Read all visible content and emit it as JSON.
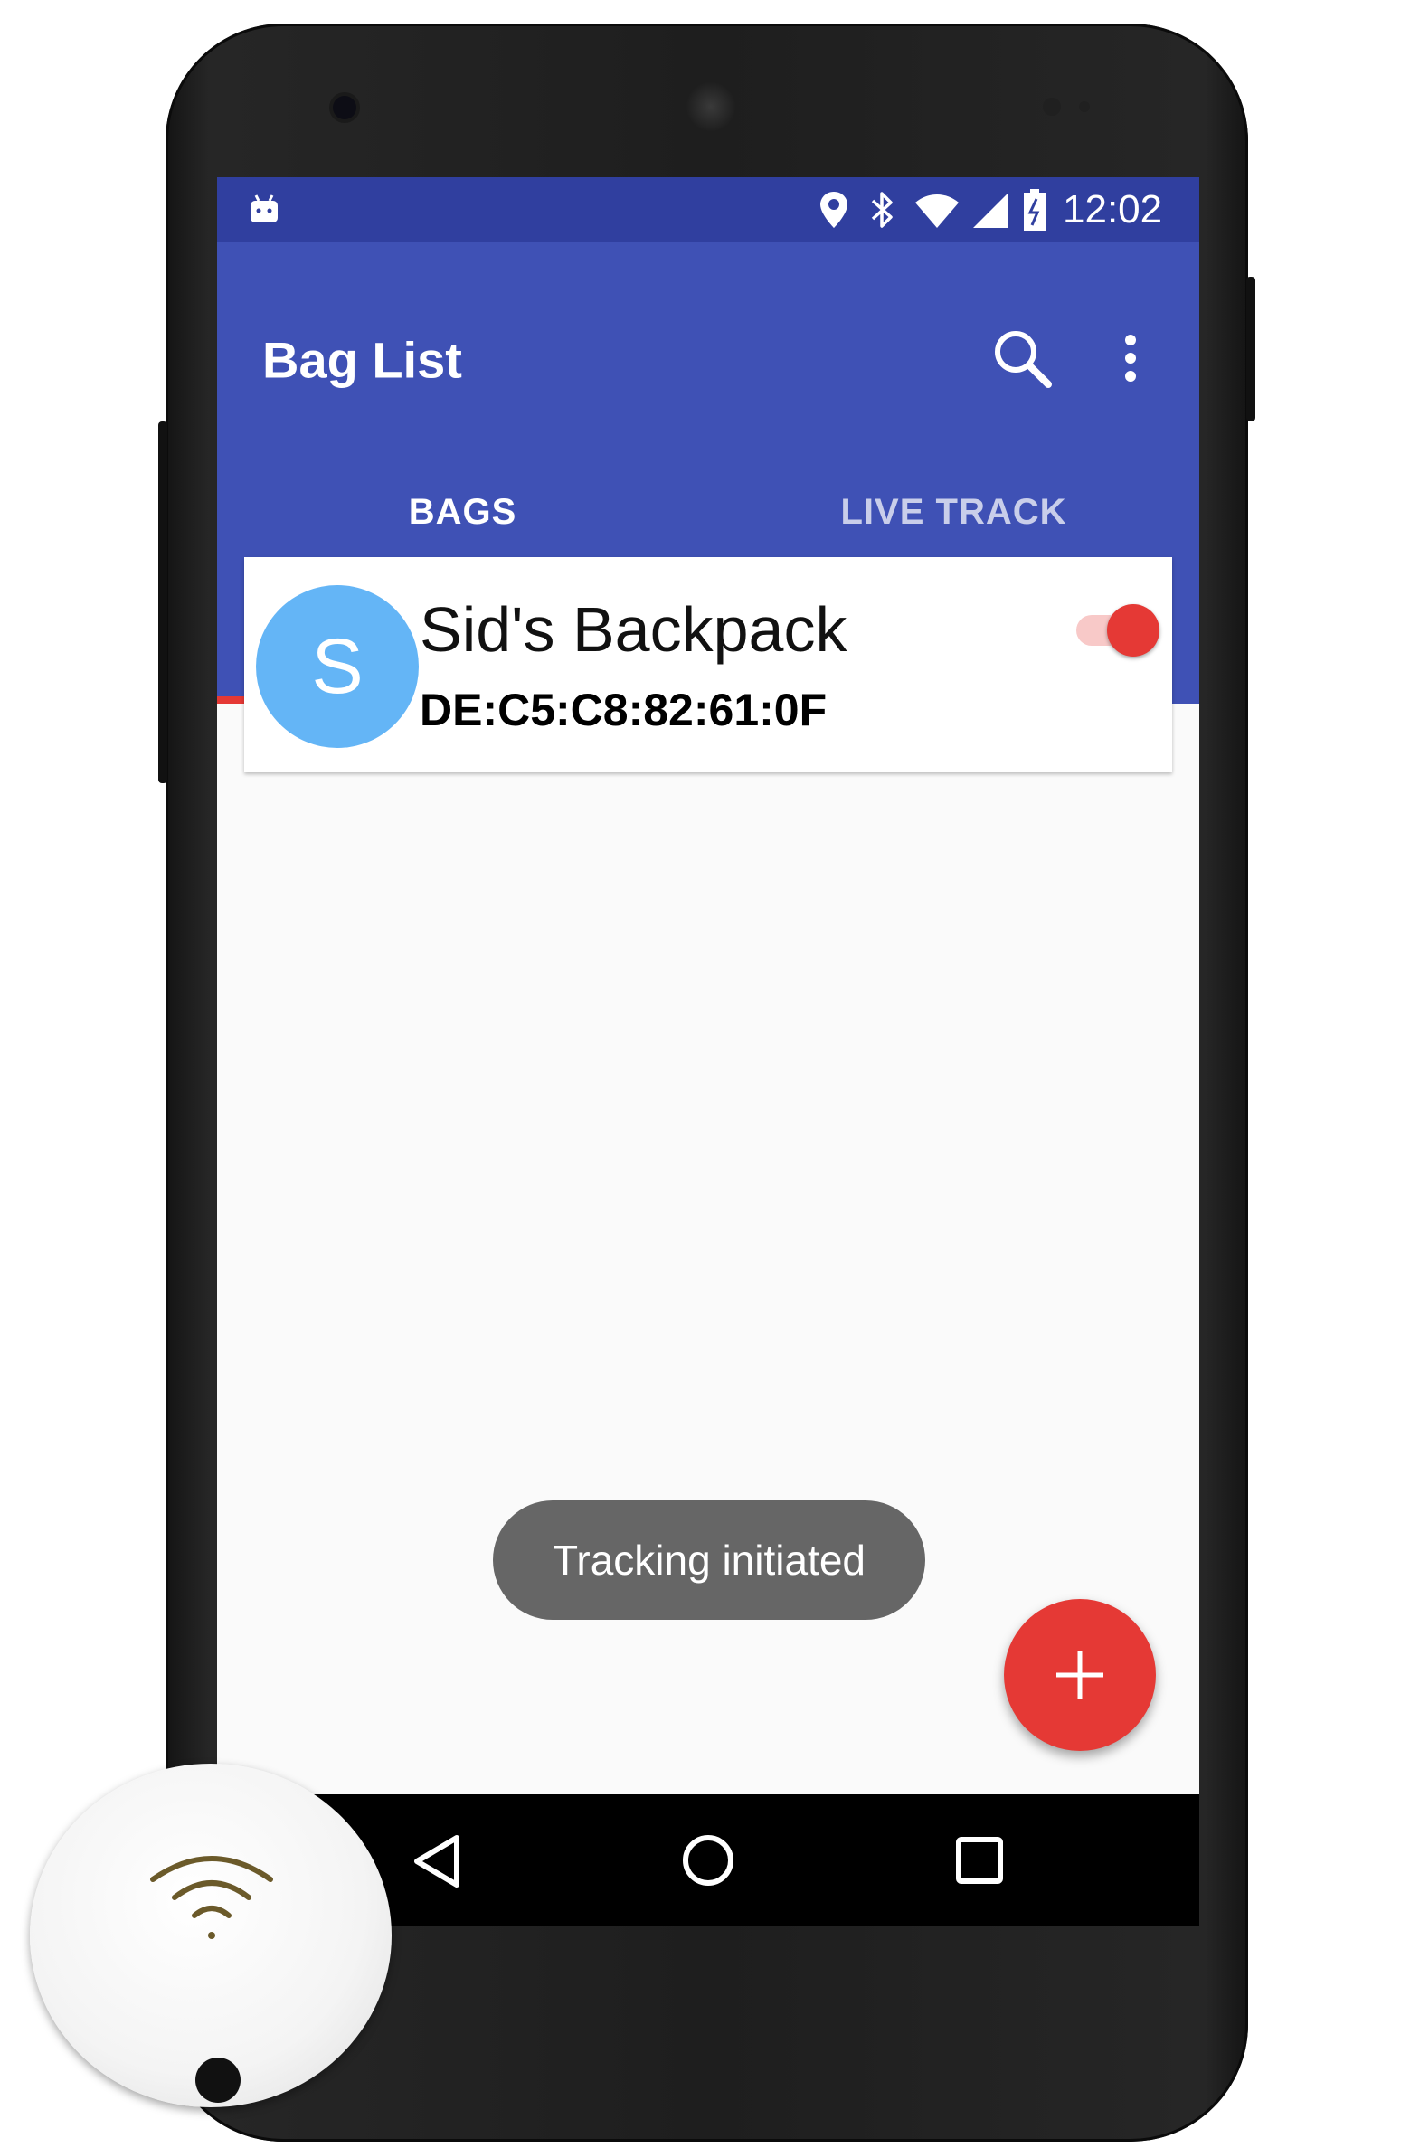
{
  "status_bar": {
    "time": "12:02",
    "icons": [
      "android-notification-icon",
      "location-pin-icon",
      "bluetooth-icon",
      "wifi-icon",
      "cell-signal-icon",
      "battery-charging-icon"
    ]
  },
  "app_bar": {
    "title": "Bag List",
    "actions": [
      "search-icon",
      "more-vert-icon"
    ]
  },
  "tabs": [
    {
      "label": "BAGS",
      "selected": true
    },
    {
      "label": "LIVE TRACK",
      "selected": false
    }
  ],
  "bags": [
    {
      "avatar_letter": "S",
      "name": "Sid's Backpack",
      "mac": "DE:C5:C8:82:61:0F",
      "tracking_enabled": true
    }
  ],
  "toast": "Tracking initiated",
  "fab": {
    "icon": "add-icon"
  },
  "nav_bar": [
    "back-icon",
    "home-icon",
    "recents-icon"
  ],
  "colors": {
    "status_bar": "#303f9f",
    "primary": "#3f51b5",
    "accent": "#e53935",
    "avatar": "#64b5f6",
    "toast": "#666666"
  }
}
